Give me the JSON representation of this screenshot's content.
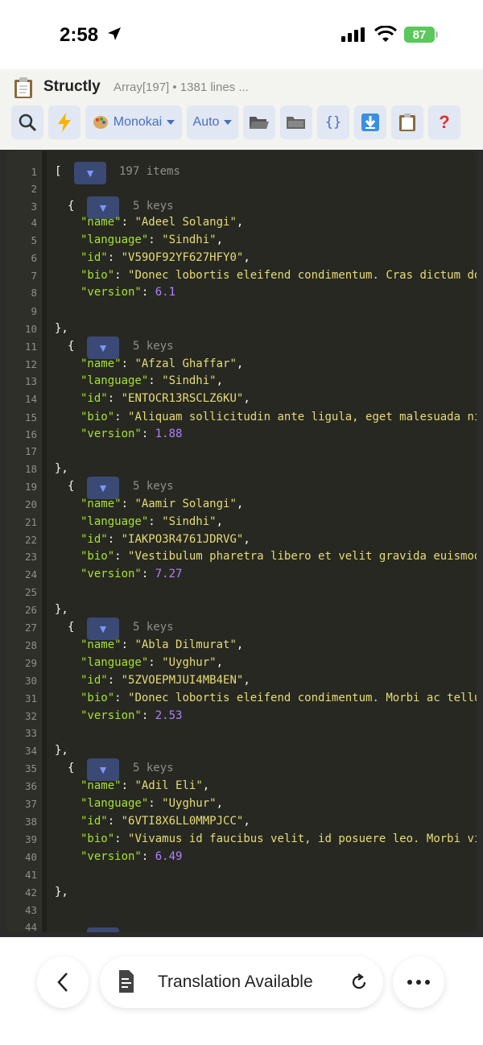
{
  "status_bar": {
    "time": "2:58",
    "battery": "87"
  },
  "app": {
    "title": "Structly",
    "meta": "Array[197] • 1381 lines ..."
  },
  "toolbar": {
    "theme_select": "Monokai",
    "mode_select": "Auto",
    "braces_label": "{}",
    "help_label": "?"
  },
  "editor": {
    "root": {
      "open": "[",
      "count": "197 items"
    },
    "items": [
      {
        "count": "5 keys",
        "name": "Adeel Solangi",
        "language": "Sindhi",
        "id": "V59OF92YF627HFY0",
        "bio": "Donec lobortis eleifend condimentum. Cras dictum dol",
        "version": "6.1"
      },
      {
        "count": "5 keys",
        "name": "Afzal Ghaffar",
        "language": "Sindhi",
        "id": "ENTOCR13RSCLZ6KU",
        "bio": "Aliquam sollicitudin ante ligula, eget malesuada nib",
        "version": "1.88"
      },
      {
        "count": "5 keys",
        "name": "Aamir Solangi",
        "language": "Sindhi",
        "id": "IAKPO3R4761JDRVG",
        "bio": "Vestibulum pharetra libero et velit gravida euismod.",
        "version": "7.27"
      },
      {
        "count": "5 keys",
        "name": "Abla Dilmurat",
        "language": "Uyghur",
        "id": "5ZVOEPMJUI4MB4EN",
        "bio": "Donec lobortis eleifend condimentum. Morbi ac tellus",
        "version": "2.53"
      },
      {
        "count": "5 keys",
        "name": "Adil Eli",
        "language": "Uyghur",
        "id": "6VTI8X6LL0MMPJCC",
        "bio": "Vivamus id faucibus velit, id posuere leo. Morbi vit",
        "version": "6.49"
      }
    ],
    "keys": {
      "name": "\"name\"",
      "language": "\"language\"",
      "id": "\"id\"",
      "bio": "\"bio\"",
      "version": "\"version\""
    }
  },
  "bottom_bar": {
    "translation_label": "Translation Available"
  },
  "colors": {
    "key": "#a6e22e",
    "string": "#e6db74",
    "number": "#ae81ff",
    "bg": "#272822"
  }
}
